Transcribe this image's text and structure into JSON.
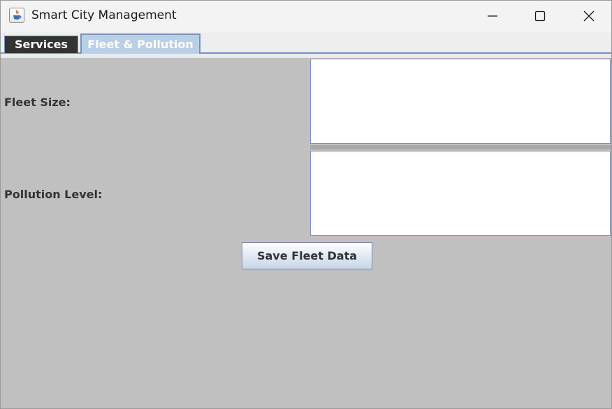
{
  "window": {
    "title": "Smart City Management",
    "app_icon": "java-coffee-cup-icon",
    "controls": {
      "minimize_icon": "minimize-icon",
      "maximize_icon": "maximize-icon",
      "close_icon": "close-icon"
    }
  },
  "tabs": [
    {
      "label": "Services",
      "selected": false
    },
    {
      "label": "Fleet & Pollution",
      "selected": true
    }
  ],
  "form": {
    "fleet_size_label": "Fleet Size:",
    "fleet_size_value": "",
    "pollution_level_label": "Pollution Level:",
    "pollution_level_value": "",
    "save_button_label": "Save Fleet Data"
  },
  "colors": {
    "panel_background": "#c0c0c0",
    "selected_tab": "#b8cfe5",
    "unselected_tab": "#333333",
    "accent_border": "#7a90c0"
  }
}
